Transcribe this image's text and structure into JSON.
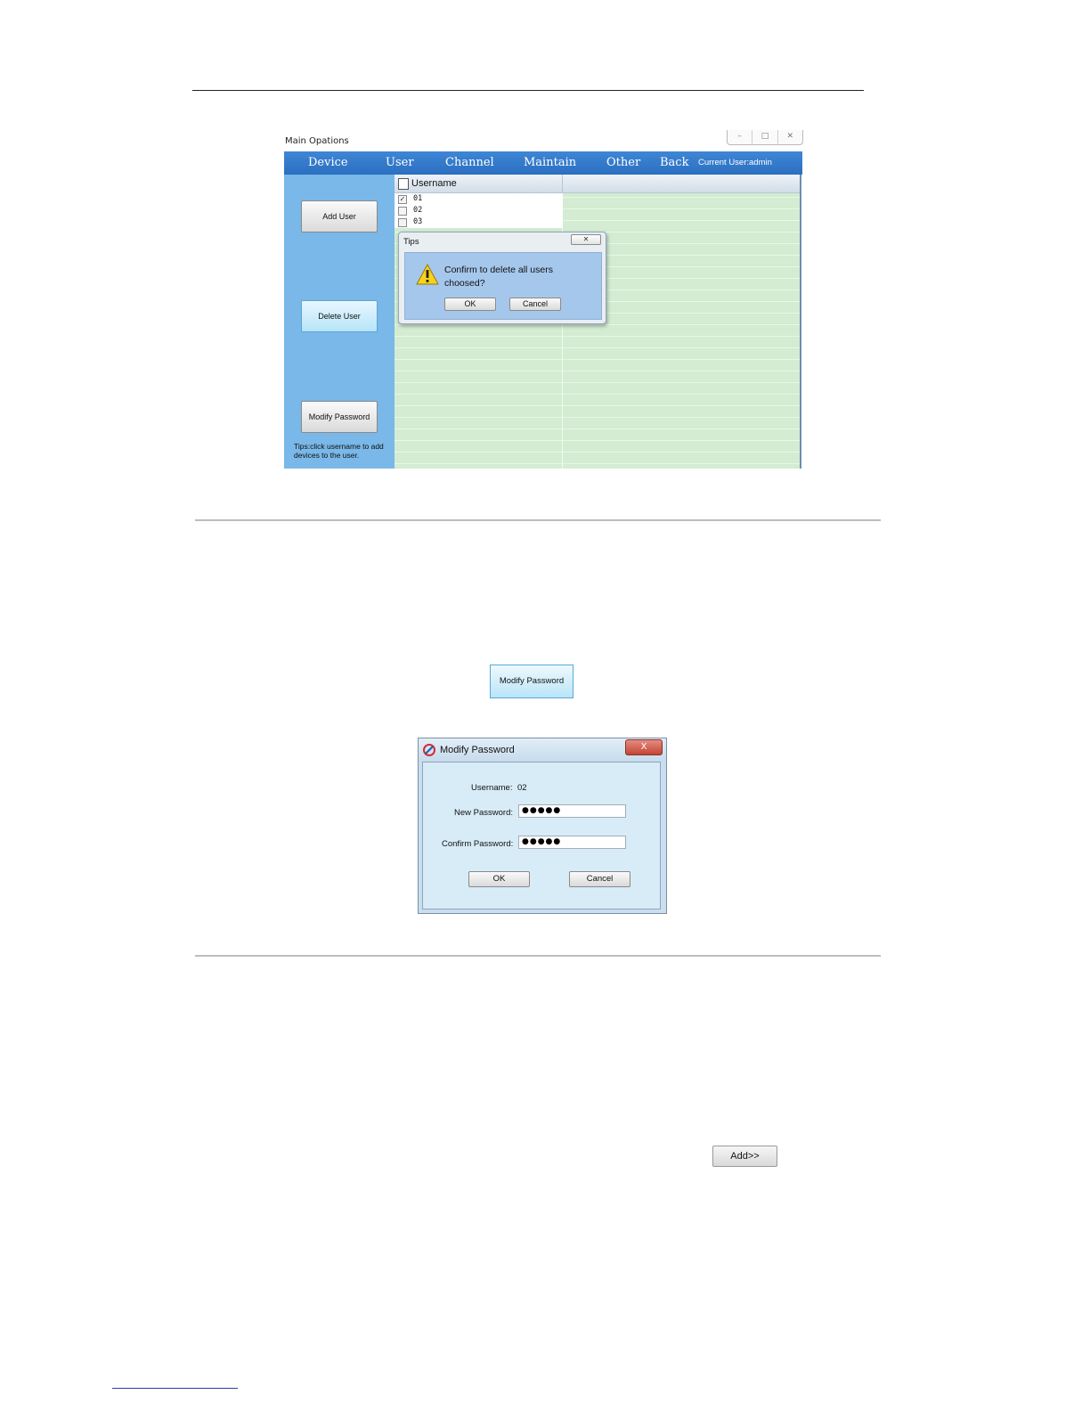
{
  "main_window": {
    "title": "Main Opations",
    "controls": {
      "minimize": "–",
      "maximize": "□",
      "close": "✕"
    },
    "menu": [
      "Device",
      "User",
      "Channel",
      "Maintain",
      "Other",
      "Back"
    ],
    "current_user": "Current User:admin",
    "left_buttons": {
      "add_user": "Add User",
      "delete_user": "Delete User",
      "modify_password": "Modify Password"
    },
    "tip_text": "Tips:click username to add devices to the user.",
    "table": {
      "header": "Username",
      "rows": [
        {
          "name": "01",
          "checked": true
        },
        {
          "name": "02",
          "checked": false
        },
        {
          "name": "03",
          "checked": false
        }
      ]
    },
    "tips_dialog": {
      "title": "Tips",
      "close": "✕",
      "message": "Confirm to delete all users choosed?",
      "ok": "OK",
      "cancel": "Cancel"
    }
  },
  "modify_password_button": "Modify Password",
  "modify_password_dialog": {
    "title": "Modify Password",
    "close": "X",
    "username_label": "Username:",
    "username_value": "02",
    "new_password_label": "New Password:",
    "new_password_value": "●●●●●",
    "confirm_password_label": "Confirm Password:",
    "confirm_password_value": "●●●●●",
    "ok": "OK",
    "cancel": "Cancel"
  },
  "add_button": "Add>>",
  "colors": {
    "menu_blue": "#2b6fc0",
    "panel_blue": "#79b8e8",
    "grid_green": "#d3ecd2"
  }
}
